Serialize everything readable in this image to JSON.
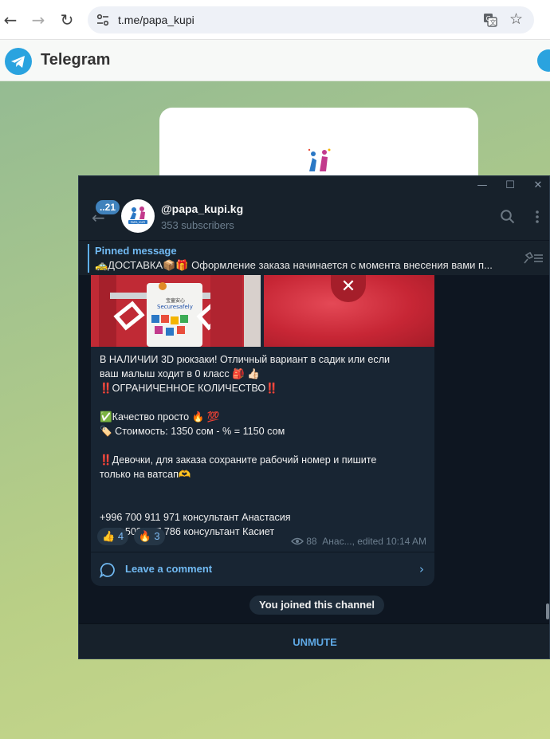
{
  "browser": {
    "url": "t.me/papa_kupi",
    "icons": [
      "back-icon",
      "forward-icon",
      "reload-icon",
      "site-settings-icon",
      "translate-icon",
      "bookmark-star-icon"
    ]
  },
  "web_header": {
    "title": "Telegram"
  },
  "window": {
    "controls": [
      "minimize",
      "maximize",
      "close"
    ]
  },
  "chat_header": {
    "unread_count": "..21",
    "channel_name": "@papa_kupi.kg",
    "subscribers": "353 subscribers"
  },
  "pinned": {
    "title": "Pinned message",
    "text": "🚕ДОСТАВКА📦🎁 Оформление заказа начинается с момента внесения вами п..."
  },
  "message": {
    "lines": [
      "В НАЛИЧИИ 3D рюкзаки! Отличный вариант в садик или если",
      "ваш малыш ходит в 0 класс 🎒 👍🏻",
      "‼️ОГРАНИЧЕННОЕ КОЛИЧЕСТВО‼️",
      "",
      "✅Качество просто 🔥 💯",
      "🏷️ Стоимость: 1350 сом - % = 1150 сом",
      "",
      "‼️Девочки, для заказа сохраните рабочий номер и пишите",
      "только на ватсап🫶",
      "",
      "",
      "+996 700 911 971 консультант Анастасия",
      "+996 508 887 786 консультант Касиет"
    ],
    "reactions": [
      {
        "emoji": "👍",
        "count": "4"
      },
      {
        "emoji": "🔥",
        "count": "3"
      }
    ],
    "views": "88",
    "meta": "Анас..., edited 10:14 AM",
    "comment_label": "Leave a comment"
  },
  "service_message": "You joined this channel",
  "bottom": {
    "unmute_label": "UNMUTE"
  },
  "colors": {
    "window_bg": "#0e1621",
    "panel_bg": "#17212b",
    "bubble_bg": "#182533",
    "accent": "#71baf3",
    "telegram_blue": "#2aa3df"
  }
}
